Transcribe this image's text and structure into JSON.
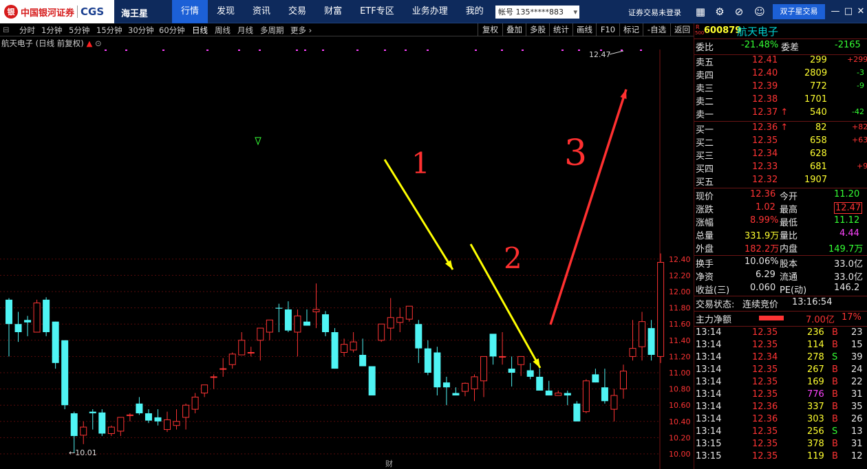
{
  "app": {
    "logo_mark": "银",
    "brand": "中国银河证券",
    "brand_abbr": "CGS",
    "name": "海王星",
    "menu": [
      "行情",
      "发现",
      "资讯",
      "交易",
      "财富",
      "ETF专区",
      "业务办理",
      "我的"
    ],
    "menu_active": 0,
    "account": "帐号 135*****883",
    "login_status": "证券交易未登录",
    "dual_button": "双子星交易",
    "icons": [
      "grid-icon",
      "settings-icon",
      "link-icon",
      "chat-icon"
    ],
    "window_buttons": [
      "minimize",
      "maximize",
      "close"
    ]
  },
  "toolbar": {
    "periods": [
      "分时",
      "1分钟",
      "5分钟",
      "15分钟",
      "30分钟",
      "60分钟",
      "日线",
      "周线",
      "月线",
      "多周期",
      "更多"
    ],
    "period_active": 6,
    "buttons": [
      "复权",
      "叠加",
      "多股",
      "统计",
      "画线",
      "F10",
      "标记",
      "-自选",
      "返回"
    ]
  },
  "chart": {
    "info": "航天电子 (日线 前复权)",
    "high_label": "12.47",
    "low_label": "10.01",
    "cai_label": "财",
    "annotations": [
      "1",
      "2",
      "3"
    ],
    "price_ticks": [
      "12.40",
      "12.20",
      "12.00",
      "11.80",
      "11.60",
      "11.40",
      "11.20",
      "11.00",
      "10.80",
      "10.60",
      "10.40",
      "10.20",
      "10.00"
    ],
    "up_color": "#ff3434",
    "down_color": "#4ff4f4"
  },
  "chart_data": {
    "type": "candlestick",
    "ylim": [
      10.0,
      12.47
    ],
    "candles": [
      [
        11.9,
        11.92,
        11.2,
        11.6
      ],
      [
        11.6,
        11.75,
        11.38,
        11.5
      ],
      [
        11.65,
        11.7,
        11.45,
        11.62
      ],
      [
        11.5,
        11.9,
        11.5,
        11.86
      ],
      [
        11.9,
        11.93,
        11.45,
        11.5
      ],
      [
        11.63,
        11.63,
        11.05,
        11.12
      ],
      [
        11.4,
        11.4,
        10.55,
        10.6
      ],
      [
        10.5,
        10.52,
        10.01,
        10.22
      ],
      [
        10.23,
        10.4,
        10.12,
        10.33
      ],
      [
        10.52,
        10.55,
        10.3,
        10.5
      ],
      [
        10.51,
        10.55,
        10.22,
        10.25
      ],
      [
        10.25,
        10.35,
        10.22,
        10.33
      ],
      [
        10.28,
        10.4,
        10.22,
        10.45
      ],
      [
        10.48,
        10.5,
        10.4,
        10.48
      ],
      [
        10.62,
        10.7,
        10.48,
        10.5
      ],
      [
        10.5,
        10.55,
        10.38,
        10.41
      ],
      [
        10.45,
        10.55,
        10.35,
        10.4
      ],
      [
        10.3,
        10.52,
        10.27,
        10.42
      ],
      [
        10.35,
        10.55,
        10.3,
        10.4
      ],
      [
        10.45,
        10.62,
        10.3,
        10.6
      ],
      [
        10.55,
        10.75,
        10.5,
        10.7
      ],
      [
        10.75,
        10.85,
        10.7,
        10.85
      ],
      [
        10.95,
        10.98,
        10.8,
        10.95
      ],
      [
        11.05,
        11.18,
        10.95,
        11.05
      ],
      [
        11.1,
        11.25,
        11.05,
        11.23
      ],
      [
        11.22,
        11.5,
        11.22,
        11.4
      ],
      [
        11.25,
        11.32,
        11.2,
        11.25
      ],
      [
        11.4,
        11.5,
        11.15,
        11.55
      ],
      [
        11.5,
        11.62,
        11.4,
        11.65
      ],
      [
        11.8,
        11.85,
        11.5,
        11.79
      ],
      [
        11.78,
        11.88,
        11.5,
        11.52
      ],
      [
        11.5,
        11.78,
        11.2,
        11.7
      ],
      [
        11.63,
        11.78,
        11.58,
        11.58
      ],
      [
        11.75,
        12.1,
        11.55,
        11.78
      ],
      [
        11.72,
        11.76,
        11.45,
        11.5
      ],
      [
        11.5,
        11.55,
        11.05,
        11.05
      ],
      [
        11.25,
        11.42,
        11.2,
        11.35
      ],
      [
        11.28,
        11.5,
        11.25,
        11.38
      ],
      [
        11.22,
        11.42,
        11.1,
        11.08
      ],
      [
        11.08,
        11.05,
        11.05,
        10.72
      ],
      [
        11.4,
        11.6,
        11.38,
        11.6
      ],
      [
        11.55,
        11.92,
        11.4,
        11.68
      ],
      [
        11.62,
        11.8,
        11.5,
        11.68
      ],
      [
        11.66,
        11.78,
        11.63,
        11.82
      ],
      [
        11.6,
        11.65,
        11.12,
        11.3
      ],
      [
        11.3,
        11.4,
        10.97,
        11.0
      ],
      [
        11.25,
        11.32,
        10.72,
        10.82
      ],
      [
        10.88,
        10.95,
        10.6,
        10.82
      ],
      [
        10.75,
        10.82,
        10.72,
        10.72
      ],
      [
        10.77,
        10.88,
        10.71,
        10.87
      ],
      [
        10.8,
        10.98,
        10.65,
        10.95
      ],
      [
        10.9,
        11.1,
        10.7,
        11.2
      ],
      [
        11.48,
        11.22,
        11.1,
        11.2
      ],
      [
        11.2,
        11.5,
        11.1,
        11.2
      ],
      [
        11.05,
        11.2,
        10.83,
        11.0
      ],
      [
        11.1,
        11.18,
        10.96,
        11.2
      ],
      [
        11.03,
        11.12,
        10.92,
        10.95
      ],
      [
        10.95,
        11.05,
        10.8,
        10.78
      ],
      [
        10.78,
        10.9,
        10.72,
        10.72
      ],
      [
        10.72,
        10.78,
        10.72,
        10.75
      ],
      [
        10.75,
        10.78,
        10.6,
        10.72
      ],
      [
        10.62,
        10.65,
        10.4,
        10.4
      ],
      [
        10.52,
        10.92,
        10.5,
        10.9
      ],
      [
        10.98,
        11.05,
        10.88,
        10.88
      ],
      [
        10.82,
        11.05,
        10.62,
        10.65
      ],
      [
        10.55,
        10.8,
        10.4,
        10.72
      ],
      [
        10.8,
        11.1,
        10.68,
        11.02
      ],
      [
        11.2,
        11.65,
        11.15,
        11.3
      ],
      [
        11.32,
        11.75,
        11.15,
        11.63
      ],
      [
        11.55,
        11.65,
        11.15,
        11.22
      ],
      [
        11.2,
        11.5,
        11.12,
        12.36
      ]
    ],
    "last_up_wick_high": 12.47
  },
  "quote": {
    "code": "600879",
    "name": "航天电子",
    "badge_top": "R",
    "badge_bottom": "500",
    "wei_bi_label": "委比",
    "wei_bi": "-21.48%",
    "wei_cha_label": "委差",
    "wei_cha": "-2165",
    "asks": [
      {
        "label": "卖五",
        "price": "12.41",
        "vol": "299",
        "chg": "+299",
        "price_cls": "r",
        "chg_cls": "r"
      },
      {
        "label": "卖四",
        "price": "12.40",
        "vol": "2809",
        "chg": "-3",
        "price_cls": "r",
        "chg_cls": "g"
      },
      {
        "label": "卖三",
        "price": "12.39",
        "vol": "772",
        "chg": "-9",
        "price_cls": "r",
        "chg_cls": "g"
      },
      {
        "label": "卖二",
        "price": "12.38",
        "vol": "1701",
        "chg": "",
        "price_cls": "r",
        "chg_cls": "g"
      },
      {
        "label": "卖一",
        "price": "12.37",
        "vol": "540",
        "chg": "-42",
        "price_cls": "r",
        "chg_cls": "g",
        "arrow": "↑"
      }
    ],
    "bids": [
      {
        "label": "买一",
        "price": "12.36",
        "vol": "82",
        "chg": "+82",
        "price_cls": "r",
        "chg_cls": "r",
        "arrow": "↑"
      },
      {
        "label": "买二",
        "price": "12.35",
        "vol": "658",
        "chg": "+63",
        "price_cls": "r",
        "chg_cls": "r"
      },
      {
        "label": "买三",
        "price": "12.34",
        "vol": "628",
        "chg": "",
        "price_cls": "r",
        "chg_cls": "r"
      },
      {
        "label": "买四",
        "price": "12.33",
        "vol": "681",
        "chg": "+9",
        "price_cls": "r",
        "chg_cls": "r"
      },
      {
        "label": "买五",
        "price": "12.32",
        "vol": "1907",
        "chg": "",
        "price_cls": "r",
        "chg_cls": "r"
      }
    ],
    "stats": [
      {
        "l1": "现价",
        "v1": "12.36",
        "c1": "r",
        "l2": "今开",
        "v2": "11.20",
        "c2": "g"
      },
      {
        "l1": "涨跌",
        "v1": "1.02",
        "c1": "r",
        "l2": "最高",
        "v2": "12.47",
        "c2": "r",
        "box2": true
      },
      {
        "l1": "涨幅",
        "v1": "8.99%",
        "c1": "r",
        "l2": "最低",
        "v2": "11.12",
        "c2": "g"
      },
      {
        "l1": "总量",
        "v1": "331.9万",
        "c1": "y",
        "l2": "量比",
        "v2": "4.44",
        "c2": "m"
      },
      {
        "l1": "外盘",
        "v1": "182.2万",
        "c1": "r",
        "l2": "内盘",
        "v2": "149.7万",
        "c2": "g"
      }
    ],
    "stats2": [
      {
        "l1": "换手",
        "v1": "10.06%",
        "l2": "股本",
        "v2": "33.0亿"
      },
      {
        "l1": "净资",
        "v1": "6.29",
        "l2": "流通",
        "v2": "33.0亿"
      },
      {
        "l1": "收益(三)",
        "v1": "0.060",
        "l2": "PE(动)",
        "v2": "146.2"
      }
    ],
    "trade_state_label": "交易状态:",
    "trade_state": "连续竞价",
    "trade_time": "13:16:54",
    "main_flow_label": "主力净额",
    "main_flow": "7.00亿",
    "main_flow_pct": "17%",
    "ticks": [
      {
        "t": "13:14",
        "p": "12.35",
        "v": "236",
        "s": "B",
        "n": "23",
        "pc": "r",
        "vc": "y",
        "sc": "r"
      },
      {
        "t": "13:14",
        "p": "12.35",
        "v": "114",
        "s": "B",
        "n": "15",
        "pc": "r",
        "vc": "y",
        "sc": "r"
      },
      {
        "t": "13:14",
        "p": "12.34",
        "v": "278",
        "s": "S",
        "n": "39",
        "pc": "r",
        "vc": "y",
        "sc": "g"
      },
      {
        "t": "13:14",
        "p": "12.35",
        "v": "267",
        "s": "B",
        "n": "24",
        "pc": "r",
        "vc": "y",
        "sc": "r"
      },
      {
        "t": "13:14",
        "p": "12.35",
        "v": "169",
        "s": "B",
        "n": "22",
        "pc": "r",
        "vc": "y",
        "sc": "r"
      },
      {
        "t": "13:14",
        "p": "12.35",
        "v": "776",
        "s": "B",
        "n": "31",
        "pc": "r",
        "vc": "m",
        "sc": "r"
      },
      {
        "t": "13:14",
        "p": "12.36",
        "v": "337",
        "s": "B",
        "n": "35",
        "pc": "r",
        "vc": "y",
        "sc": "r"
      },
      {
        "t": "13:14",
        "p": "12.36",
        "v": "303",
        "s": "B",
        "n": "26",
        "pc": "r",
        "vc": "y",
        "sc": "r"
      },
      {
        "t": "13:14",
        "p": "12.35",
        "v": "256",
        "s": "S",
        "n": "13",
        "pc": "r",
        "vc": "y",
        "sc": "g"
      },
      {
        "t": "13:15",
        "p": "12.35",
        "v": "378",
        "s": "B",
        "n": "31",
        "pc": "r",
        "vc": "y",
        "sc": "r"
      },
      {
        "t": "13:15",
        "p": "12.35",
        "v": "119",
        "s": "B",
        "n": "12",
        "pc": "r",
        "vc": "y",
        "sc": "r"
      }
    ]
  }
}
